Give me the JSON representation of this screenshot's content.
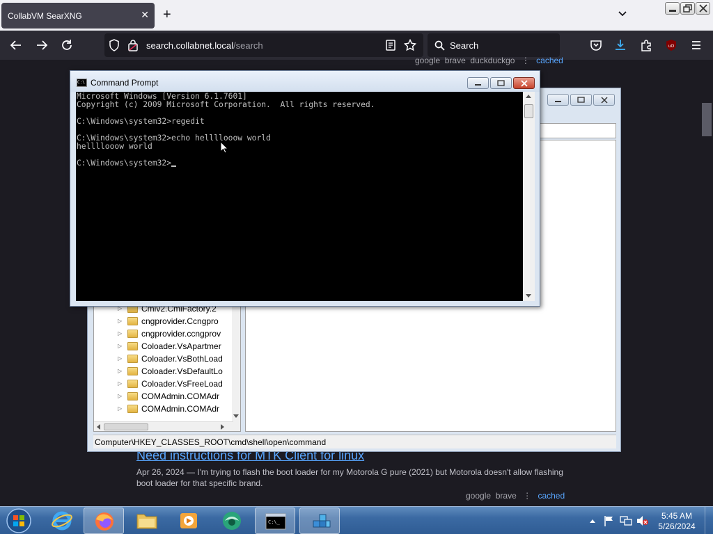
{
  "browser": {
    "tab_title": "CollabVM SearXNG",
    "url_host": "search.collabnet.local",
    "url_path": "/search",
    "search_placeholder": "Search"
  },
  "page": {
    "top_result_links": [
      "google",
      "brave",
      "duckduckgo"
    ],
    "cached_label": "cached",
    "result": {
      "title": "Need instructions for MTK Client for linux",
      "snippet": "Apr 26, 2024 — I'm trying to flash the boot loader for my Motorola G pure (2021) but Motorola doesn't allow flashing boot loader for that specific brand.",
      "links": [
        "google",
        "brave"
      ]
    }
  },
  "regedit": {
    "tree_items": [
      "Cmiv2.CmiFactory.2",
      "cngprovider.Ccngpro",
      "cngprovider.ccngprov",
      "Coloader.VsApartmer",
      "Coloader.VsBothLoad",
      "Coloader.VsDefaultLo",
      "Coloader.VsFreeLoad",
      "COMAdmin.COMAdr",
      "COMAdmin.COMAdr"
    ],
    "status_path": "Computer\\HKEY_CLASSES_ROOT\\cmd\\shell\\open\\command"
  },
  "cmd": {
    "title": "Command Prompt",
    "lines": [
      "Microsoft Windows [Version 6.1.7601]",
      "Copyright (c) 2009 Microsoft Corporation.  All rights reserved.",
      "",
      "C:\\Windows\\system32>regedit",
      "",
      "C:\\Windows\\system32>echo hellllooow world",
      "hellllooow world",
      "",
      "C:\\Windows\\system32>"
    ]
  },
  "taskbar": {
    "clock_time": "5:45 AM",
    "clock_date": "5/26/2024"
  },
  "colors": {
    "link": "#58a6ff",
    "browser_bg": "#1c1b22",
    "toolbar": "#2b2a33"
  }
}
